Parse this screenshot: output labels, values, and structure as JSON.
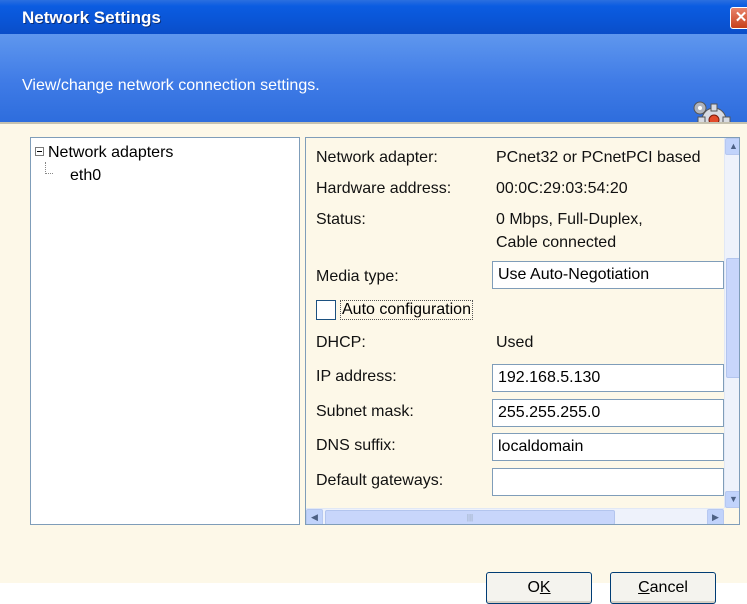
{
  "window": {
    "title": "Network Settings",
    "close_glyph": "✕"
  },
  "header": {
    "description": "View/change network connection settings.",
    "icon": "gear-icon"
  },
  "tree": {
    "root_label": "Network adapters",
    "children": [
      "eth0"
    ]
  },
  "properties": {
    "network_adapter": {
      "label": "Network adapter:",
      "value": "PCnet32 or PCnetPCI based"
    },
    "hardware_address": {
      "label": "Hardware address:",
      "value": "00:0C:29:03:54:20"
    },
    "status": {
      "label": "Status:",
      "value_line1": "0 Mbps, Full-Duplex,",
      "value_line2": "Cable connected"
    },
    "media_type": {
      "label": "Media type:",
      "value": "Use Auto-Negotiation"
    },
    "auto_configuration": {
      "label": "Auto configuration",
      "checked": false
    },
    "dhcp": {
      "label": "DHCP:",
      "value": "Used"
    },
    "ip_address": {
      "label": "IP address:",
      "value": "192.168.5.130"
    },
    "subnet_mask": {
      "label": "Subnet mask:",
      "value": "255.255.255.0"
    },
    "dns_suffix": {
      "label": "DNS suffix:",
      "value": "localdomain"
    },
    "default_gateways": {
      "label": "Default gateways:",
      "value": ""
    }
  },
  "buttons": {
    "ok": {
      "accel": "K",
      "prefix": "O"
    },
    "cancel": {
      "accel": "C",
      "suffix": "ancel"
    }
  },
  "colors": {
    "title_bar": "#0a55d6",
    "header_band": "#3f7be6",
    "dialog_background": "#fdf8e8"
  }
}
